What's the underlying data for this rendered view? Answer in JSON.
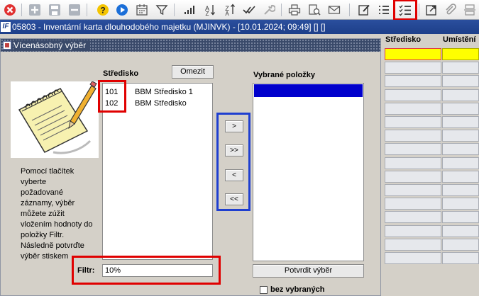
{
  "toolbar": {
    "icons": [
      "close-icon",
      "add-icon",
      "save-icon",
      "remove-icon",
      "help-icon",
      "run-icon",
      "calendar-icon",
      "filter-icon",
      "bar-chart-icon",
      "sort-ascending-icon",
      "sort-descending-icon",
      "checkmark-icon",
      "wrench-icon",
      "print-icon",
      "print-preview-icon",
      "mail-icon",
      "edit-icon",
      "list-icon",
      "checklist-icon",
      "external-link-icon",
      "attachment-icon",
      "split-icon"
    ]
  },
  "window": {
    "logo": "IF",
    "title": "05803 - Inventární karta dlouhodobého majetku (MJINVK) - [10.01.2024; 09:49] [] []"
  },
  "background_grid": {
    "columns": [
      "Středisko",
      "Umístění"
    ]
  },
  "dialog": {
    "title": "Vícenásobný výběr",
    "source_label": "Středisko",
    "clear_button": "Omezit",
    "target_label": "Vybrané položky",
    "items": [
      {
        "code": "101",
        "name": "BBM Středisko 1"
      },
      {
        "code": "102",
        "name": "BBM Středisko"
      }
    ],
    "move": {
      "one_right": ">",
      "all_right": ">>",
      "one_left": "<",
      "all_left": "<<"
    },
    "help_lines": [
      "Pomocí tlačítek",
      "vyberte",
      "požadované",
      "záznamy, výběr",
      "můžete zúžit",
      "vložením hodnoty do",
      "položky Filtr.",
      "Následně potvrďte",
      "výběr stiskem"
    ],
    "filter_label": "Filtr:",
    "filter_value": "10%",
    "confirm_button": "Potvrdit výběr",
    "checkbox_label": "bez vybraných"
  },
  "colors": {
    "highlight": "#e00000",
    "selection": "#0000cc",
    "arrow_group_border": "#1f3fd0",
    "title_bar": "#1d3f8a",
    "grid_selected": "#ffff00"
  }
}
